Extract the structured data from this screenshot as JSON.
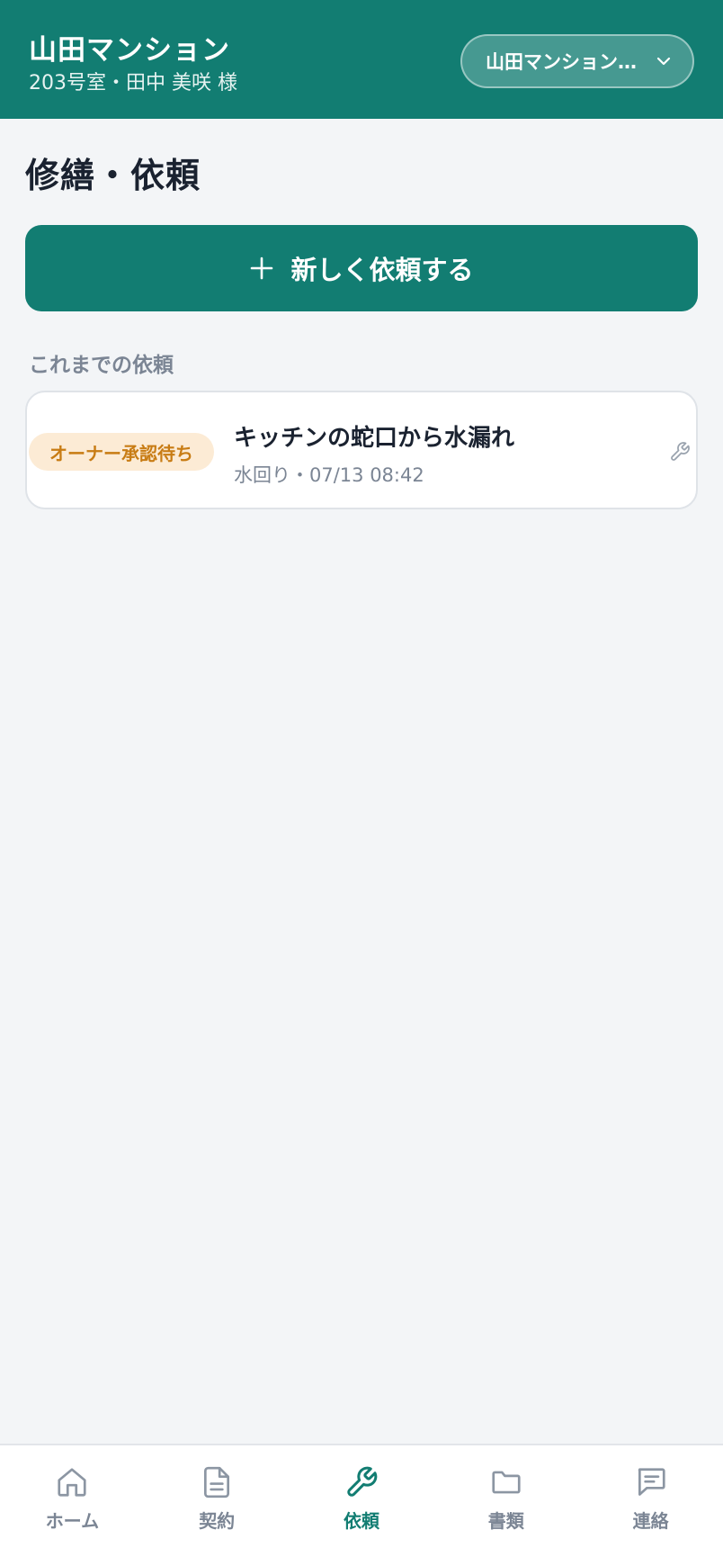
{
  "header": {
    "title": "山田マンション",
    "subtitle": "203号室・田中 美咲 様",
    "property_select": "山田マンション…"
  },
  "page": {
    "title": "修繕・依頼",
    "new_request_label": "新しく依頼する",
    "section_label": "これまでの依頼"
  },
  "requests": [
    {
      "status": "オーナー承認待ち",
      "title": "キッチンの蛇口から水漏れ",
      "meta": "水回り・07/13 08:42"
    }
  ],
  "nav": {
    "items": [
      {
        "label": "ホーム",
        "icon": "home-icon"
      },
      {
        "label": "契約",
        "icon": "document-icon"
      },
      {
        "label": "依頼",
        "icon": "wrench-icon"
      },
      {
        "label": "書類",
        "icon": "folder-icon"
      },
      {
        "label": "連絡",
        "icon": "message-icon"
      }
    ],
    "active": "依頼"
  },
  "colors": {
    "brand": "#127d72",
    "background": "#f3f5f7",
    "status_bg": "#fcebd5",
    "status_text": "#c87c14",
    "muted": "#7b8594"
  }
}
